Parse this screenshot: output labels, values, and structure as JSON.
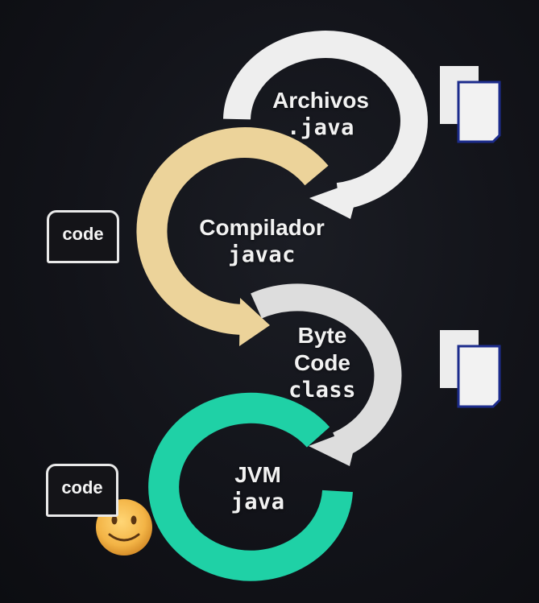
{
  "steps": [
    {
      "line1": "Archivos",
      "line2": ".java",
      "color": "#eeeeee"
    },
    {
      "line1": "Compilador",
      "line2": "javac",
      "color": "#ecd39a"
    },
    {
      "line1": "Byte",
      "line1b": "Code",
      "line2": "class",
      "color": "#dddddd"
    },
    {
      "line1": "JVM",
      "line2": "java",
      "color": "#1fd1a6"
    }
  ],
  "code_boxes": [
    {
      "label": "code"
    },
    {
      "label": "code"
    }
  ],
  "icons": {
    "documents": "copy-documents-icon",
    "smiley": "smiley-face-icon"
  }
}
